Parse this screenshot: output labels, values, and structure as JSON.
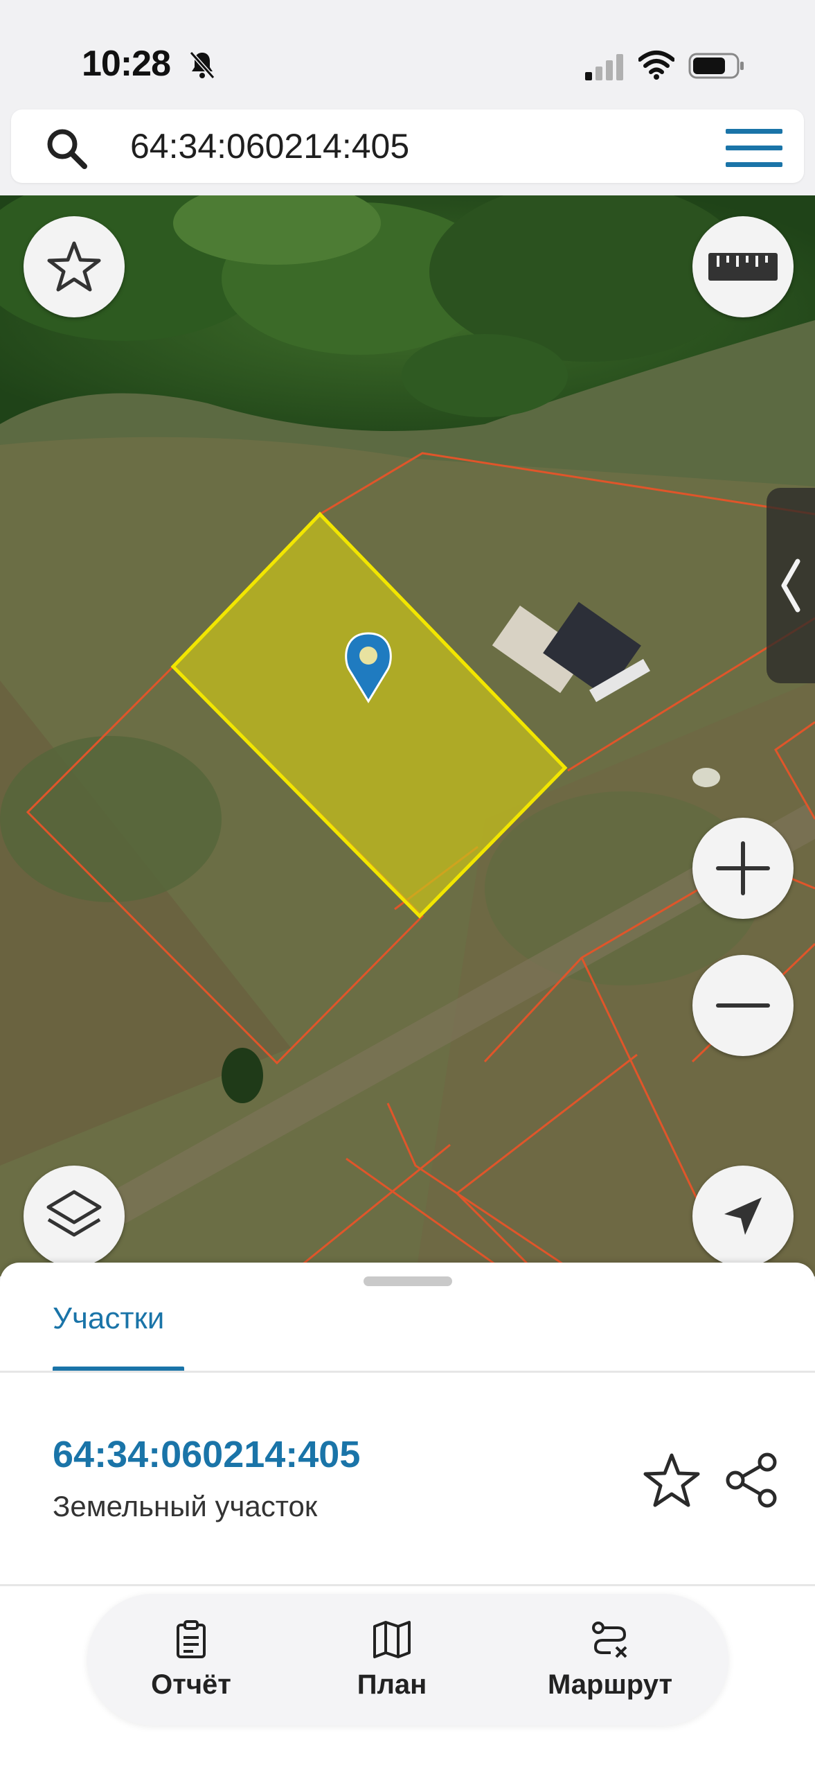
{
  "status_bar": {
    "time": "10:28"
  },
  "search": {
    "query": "64:34:060214:405"
  },
  "map": {
    "colors": {
      "selected_fill": "#c8c21a",
      "selected_stroke": "#f2e600",
      "parcel_stroke": "#e0552a",
      "pin": "#1f7bc0"
    }
  },
  "sheet": {
    "tab_label": "Участки",
    "parcel": {
      "number": "64:34:060214:405",
      "type": "Земельный участок"
    }
  },
  "actions": {
    "report_label": "Отчёт",
    "plan_label": "План",
    "route_label": "Маршрут"
  }
}
